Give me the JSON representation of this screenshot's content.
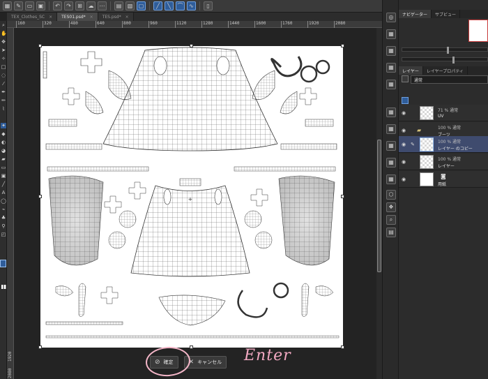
{
  "toolbar": {
    "buttons": [
      "grid-icon",
      "brush-icon",
      "folder-icon",
      "save-icon",
      "undo-icon",
      "redo-icon",
      "transform-icon",
      "cloud-icon",
      "snap-icon",
      "ruler-icon",
      "selection-icon",
      "shape-icon",
      "pen-icon",
      "line-icon",
      "curve-icon",
      "wave-icon",
      "page-icon"
    ]
  },
  "tabs": [
    {
      "label": "TEX_Clothes_SC",
      "active": false
    },
    {
      "label": "TES01.psd*",
      "active": true
    },
    {
      "label": "TES.psd*",
      "active": false
    }
  ],
  "ruler": {
    "top_ticks": [
      "160",
      "320",
      "480",
      "640",
      "800",
      "960",
      "1120",
      "1280",
      "1440",
      "1600",
      "1760",
      "1920",
      "2080"
    ],
    "left_ticks": [
      "1920",
      "2080"
    ]
  },
  "confirm": {
    "ok_label": "確定",
    "cancel_label": "キャンセル"
  },
  "annotation": {
    "enter_label": "Enter"
  },
  "right_panel": {
    "nav_tabs": [
      "ナビゲーター",
      "サブビュー"
    ],
    "layer_tabs": [
      "レイヤー",
      "レイヤープロパティ"
    ],
    "blend_mode": "通常",
    "layers": [
      {
        "mode": "71 % 通常",
        "name": "UV",
        "selected": false,
        "type": "raster"
      },
      {
        "mode": "100 % 通常",
        "name": "ブーツ",
        "selected": false,
        "type": "folder"
      },
      {
        "mode": "100 % 通常",
        "name": "レイヤー のコピー",
        "selected": true,
        "type": "raster"
      },
      {
        "mode": "100 % 通常",
        "name": "レイヤー",
        "selected": false,
        "type": "raster"
      },
      {
        "mode": "",
        "name": "用紙",
        "selected": false,
        "type": "paper"
      }
    ]
  },
  "colors": {
    "accent": "#2f5d9a",
    "annotation": "#f2a9c2",
    "selected_layer": "#3f4b6e"
  }
}
